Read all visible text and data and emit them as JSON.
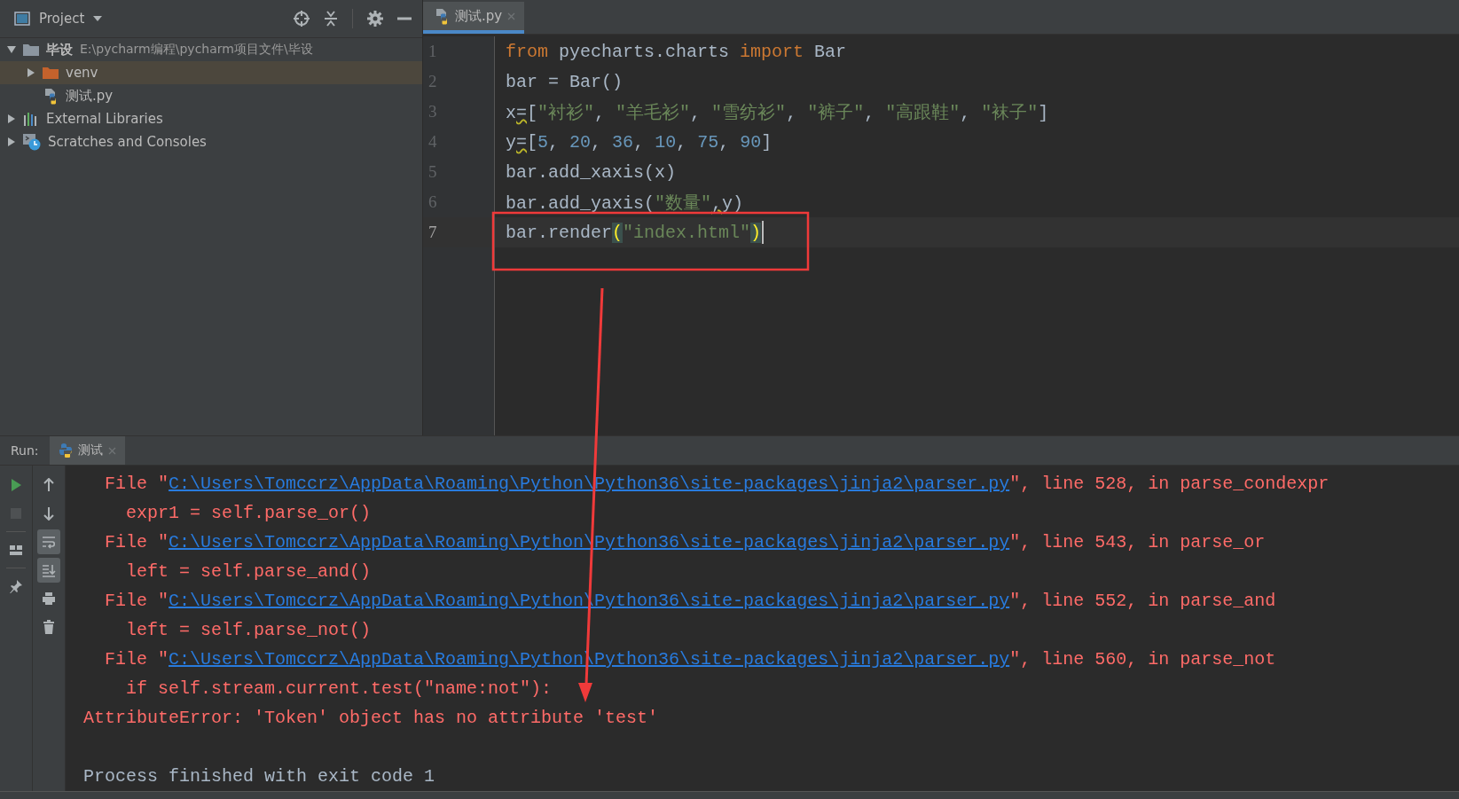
{
  "project_panel": {
    "title": "Project",
    "tree": [
      {
        "label": "毕设",
        "path": "E:\\pycharm编程\\pycharm项目文件\\毕设",
        "kind": "folder",
        "expanded": true,
        "selected": false,
        "children": [
          {
            "label": "venv",
            "kind": "excluded_folder",
            "expanded": false,
            "selected": true
          },
          {
            "label": "测试.py",
            "kind": "python_file",
            "selected": false
          }
        ]
      },
      {
        "label": "External Libraries",
        "kind": "libraries",
        "expanded": false,
        "selected": false
      },
      {
        "label": "Scratches and Consoles",
        "kind": "scratches",
        "expanded": false,
        "selected": false
      }
    ]
  },
  "editor": {
    "tabs": [
      {
        "label": "测试.py",
        "selected": true
      }
    ],
    "lines": [
      {
        "number": "1",
        "current": false,
        "tokens": [
          {
            "text": "from",
            "kind": "keyword"
          },
          {
            "text": " pyecharts.charts ",
            "kind": "plain"
          },
          {
            "text": "import",
            "kind": "keyword"
          },
          {
            "text": " Bar",
            "kind": "plain"
          }
        ]
      },
      {
        "number": "2",
        "current": false,
        "tokens": [
          {
            "text": "bar = Bar()",
            "kind": "plain"
          }
        ]
      },
      {
        "number": "3",
        "current": false,
        "tokens": [
          {
            "text": "x",
            "kind": "plain"
          },
          {
            "text": "=",
            "kind": "warning"
          },
          {
            "text": "[",
            "kind": "plain"
          },
          {
            "text": "\"衬衫\"",
            "kind": "string"
          },
          {
            "text": ", ",
            "kind": "plain"
          },
          {
            "text": "\"羊毛衫\"",
            "kind": "string"
          },
          {
            "text": ", ",
            "kind": "plain"
          },
          {
            "text": "\"雪纺衫\"",
            "kind": "string"
          },
          {
            "text": ", ",
            "kind": "plain"
          },
          {
            "text": "\"裤子\"",
            "kind": "string"
          },
          {
            "text": ", ",
            "kind": "plain"
          },
          {
            "text": "\"高跟鞋\"",
            "kind": "string"
          },
          {
            "text": ", ",
            "kind": "plain"
          },
          {
            "text": "\"袜子\"",
            "kind": "string"
          },
          {
            "text": "]",
            "kind": "plain"
          }
        ]
      },
      {
        "number": "4",
        "current": false,
        "tokens": [
          {
            "text": "y",
            "kind": "plain"
          },
          {
            "text": "=",
            "kind": "warning"
          },
          {
            "text": "[",
            "kind": "plain"
          },
          {
            "text": "5",
            "kind": "number"
          },
          {
            "text": ", ",
            "kind": "plain"
          },
          {
            "text": "20",
            "kind": "number"
          },
          {
            "text": ", ",
            "kind": "plain"
          },
          {
            "text": "36",
            "kind": "number"
          },
          {
            "text": ", ",
            "kind": "plain"
          },
          {
            "text": "10",
            "kind": "number"
          },
          {
            "text": ", ",
            "kind": "plain"
          },
          {
            "text": "75",
            "kind": "number"
          },
          {
            "text": ", ",
            "kind": "plain"
          },
          {
            "text": "90",
            "kind": "number"
          },
          {
            "text": "]",
            "kind": "plain"
          }
        ]
      },
      {
        "number": "5",
        "current": false,
        "tokens": [
          {
            "text": "bar.add_xaxis(x)",
            "kind": "plain"
          }
        ]
      },
      {
        "number": "6",
        "current": false,
        "tokens": [
          {
            "text": "bar.add_yaxis(",
            "kind": "plain"
          },
          {
            "text": "\"数量\"",
            "kind": "string"
          },
          {
            "text": ",",
            "kind": "warning"
          },
          {
            "text": "y)",
            "kind": "plain"
          }
        ]
      },
      {
        "number": "7",
        "current": true,
        "tokens": [
          {
            "text": "bar.render",
            "kind": "plain"
          },
          {
            "text": "(",
            "kind": "bracket_match"
          },
          {
            "text": "\"index.html\"",
            "kind": "string"
          },
          {
            "text": ")",
            "kind": "bracket_match"
          }
        ]
      }
    ]
  },
  "run_panel": {
    "label": "Run:",
    "tabs": [
      {
        "label": "测试",
        "selected": true
      }
    ],
    "tools_left": [
      {
        "kind": "run",
        "on": false
      },
      {
        "kind": "stop",
        "disabled": true
      },
      {
        "kind": "layout",
        "on": false
      },
      {
        "kind": "pin",
        "on": false
      }
    ],
    "tools_right": [
      {
        "kind": "up",
        "on": false
      },
      {
        "kind": "down",
        "on": false
      },
      {
        "kind": "wrap",
        "on": true
      },
      {
        "kind": "scroll_end",
        "on": true
      },
      {
        "kind": "print",
        "on": false
      },
      {
        "kind": "trash",
        "on": false
      }
    ],
    "console": [
      {
        "kind": "file",
        "prefix": "File \"",
        "link": "C:\\Users\\Tomccrz\\AppData\\Roaming\\Python\\Python36\\site-packages\\jinja2\\parser.py",
        "suffix": "\", line 528, in parse_condexpr"
      },
      {
        "kind": "code",
        "text": "expr1 = self.parse_or()"
      },
      {
        "kind": "file",
        "prefix": "File \"",
        "link": "C:\\Users\\Tomccrz\\AppData\\Roaming\\Python\\Python36\\site-packages\\jinja2\\parser.py",
        "suffix": "\", line 543, in parse_or"
      },
      {
        "kind": "code",
        "text": "left = self.parse_and()"
      },
      {
        "kind": "file",
        "prefix": "File \"",
        "link": "C:\\Users\\Tomccrz\\AppData\\Roaming\\Python\\Python36\\site-packages\\jinja2\\parser.py",
        "suffix": "\", line 552, in parse_and"
      },
      {
        "kind": "code",
        "text": "left = self.parse_not()"
      },
      {
        "kind": "file",
        "prefix": "File \"",
        "link": "C:\\Users\\Tomccrz\\AppData\\Roaming\\Python\\Python36\\site-packages\\jinja2\\parser.py",
        "suffix": "\", line 560, in parse_not"
      },
      {
        "kind": "code",
        "text": "if self.stream.current.test(\"name:not\"):"
      },
      {
        "kind": "error",
        "text": "AttributeError: 'Token' object has no attribute 'test'"
      },
      {
        "kind": "blank"
      },
      {
        "kind": "exit",
        "text": "Process finished with exit code 1"
      }
    ]
  },
  "annotations": {
    "highlight_box": true,
    "pointer_arrow": true
  }
}
